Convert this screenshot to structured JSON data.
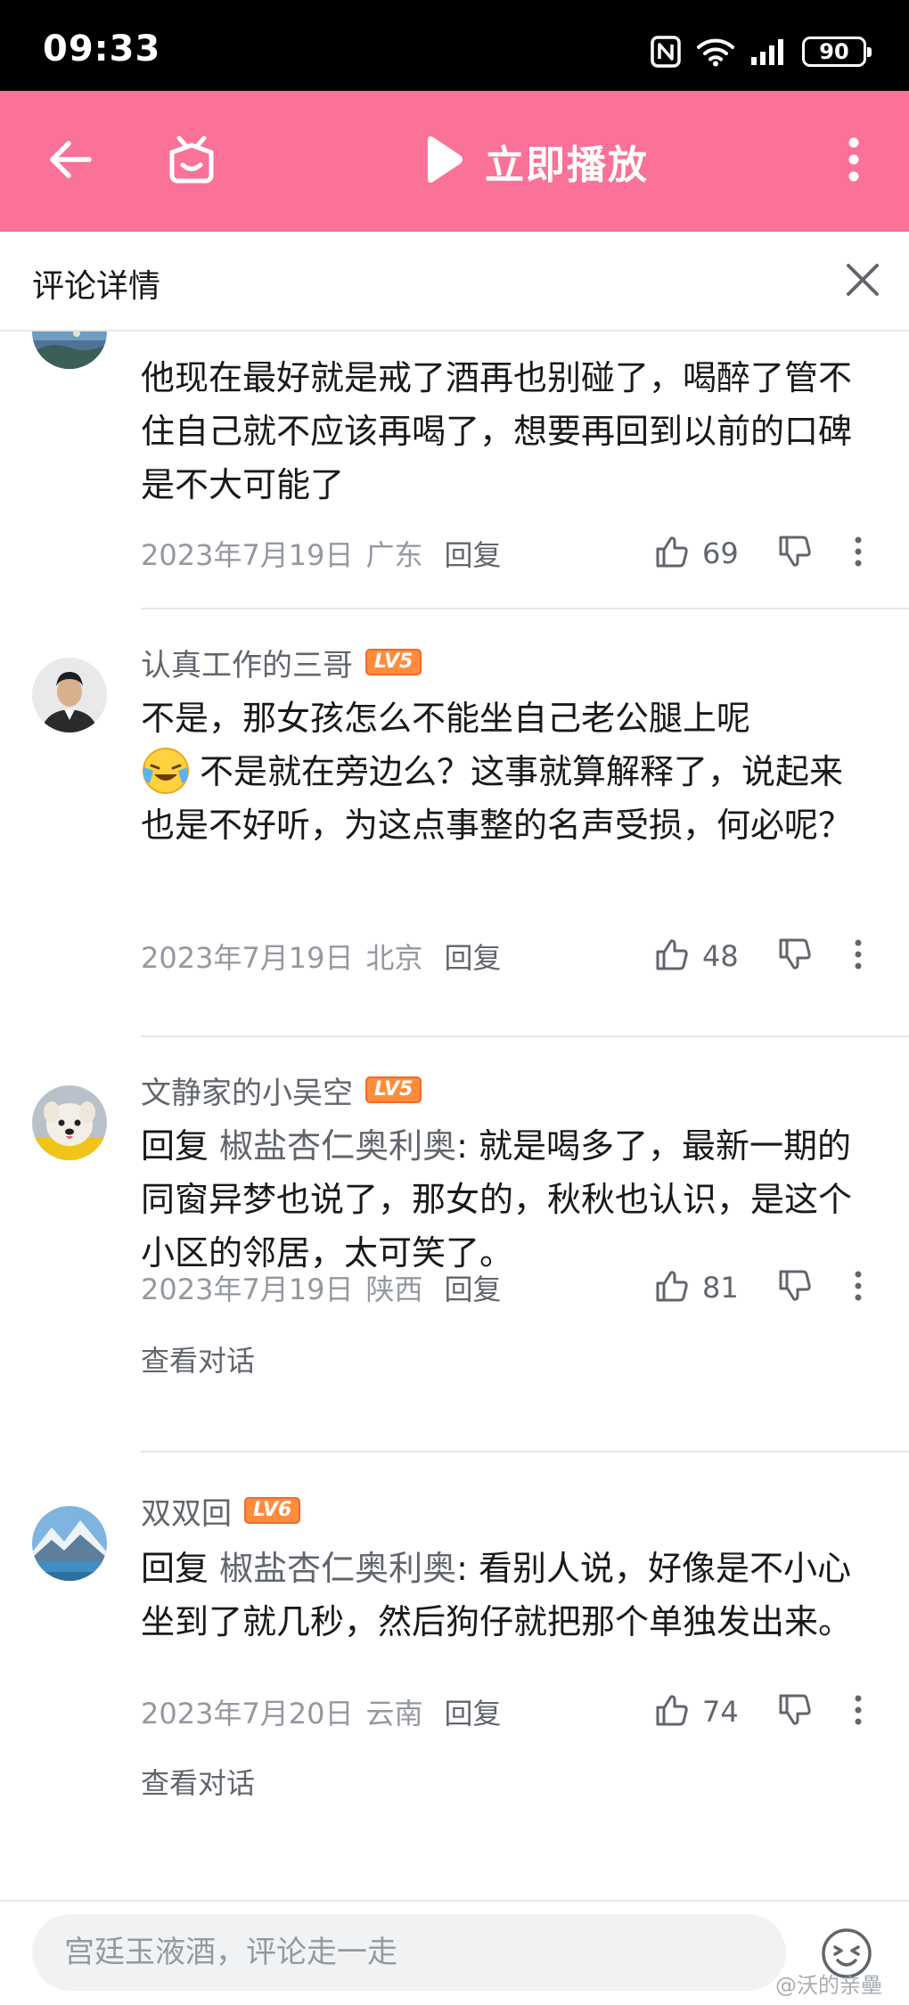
{
  "status_bar": {
    "time": "09:33",
    "battery": "90"
  },
  "header": {
    "play_label": "立即播放"
  },
  "panel": {
    "title": "评论详情"
  },
  "comments": [
    {
      "name": "",
      "level": "",
      "text": "他现在最好就是戒了酒再也别碰了，喝醉了管不住自己就不应该再喝了，想要再回到以前的口碑是不大可能了",
      "date": "2023年7月19日",
      "location": "广东",
      "reply_label": "回复",
      "likes": "69"
    },
    {
      "name": "认真工作的三哥",
      "level": "LV5",
      "text_part1": "不是，那女孩怎么不能坐自己老公腿上呢",
      "text_part2": "不是就在旁边么？这事就算解释了，说起来也是不好听，为这点事整的名声受损，何必呢？",
      "date": "2023年7月19日",
      "location": "北京",
      "reply_label": "回复",
      "likes": "48"
    },
    {
      "name": "文静家的小吴空",
      "level": "LV5",
      "reply_word": "回复",
      "reply_target": "椒盐杏仁奥利奥",
      "text": ": 就是喝多了，最新一期的同窗异梦也说了，那女的，秋秋也认识，是这个小区的邻居，太可笑了。",
      "date": "2023年7月19日",
      "location": "陕西",
      "reply_label": "回复",
      "likes": "81",
      "view_thread": "查看对话"
    },
    {
      "name": "双双回",
      "level": "LV6",
      "reply_word": "回复",
      "reply_target": "椒盐杏仁奥利奥",
      "text": ": 看别人说，好像是不小心坐到了就几秒，然后狗仔就把那个单独发出来。",
      "date": "2023年7月20日",
      "location": "云南",
      "reply_label": "回复",
      "likes": "74",
      "view_thread": "查看对话"
    }
  ],
  "bottom": {
    "placeholder": "宫廷玉液酒，评论走一走",
    "watermark": "@沃的亲壘"
  },
  "colors": {
    "brand_pink": "#fb7299",
    "level_orange": "#ff8c3c",
    "text_primary": "#18191c",
    "text_secondary": "#61666d",
    "text_muted": "#9499a0"
  },
  "icons": [
    "back-arrow-icon",
    "home-tv-icon",
    "play-icon",
    "more-vertical-icon",
    "close-icon",
    "thumb-up-icon",
    "thumb-down-icon",
    "smiley-icon",
    "nfc-icon",
    "wifi-icon",
    "signal-icon",
    "battery-icon"
  ]
}
